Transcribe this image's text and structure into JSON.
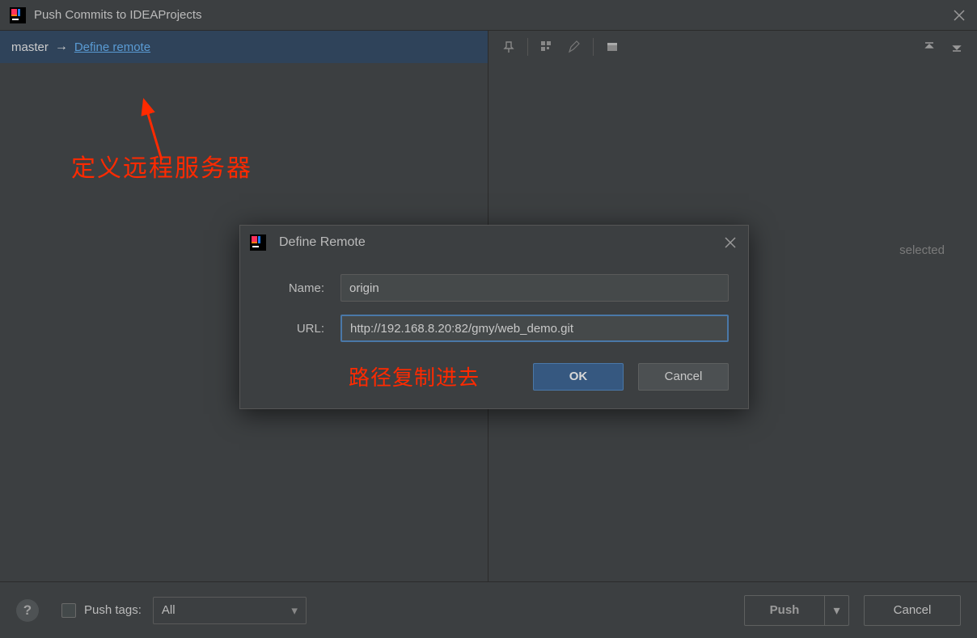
{
  "window": {
    "title": "Push Commits to IDEAProjects"
  },
  "branch": {
    "name": "master",
    "define_link": "Define remote"
  },
  "annotation": {
    "define_server": "定义远程服务器",
    "copy_path": "路径复制进去"
  },
  "right": {
    "selected": "selected"
  },
  "bottom": {
    "push_tags_label": "Push tags:",
    "tags_combo": "All",
    "push": "Push",
    "cancel": "Cancel"
  },
  "modal": {
    "title": "Define Remote",
    "name_label": "Name:",
    "name_value": "origin",
    "url_label": "URL:",
    "url_value": "http://192.168.8.20:82/gmy/web_demo.git",
    "ok": "OK",
    "cancel": "Cancel"
  },
  "colors": {
    "accent": "#365880",
    "link": "#5a9bd4",
    "annot": "#ff2a00"
  }
}
